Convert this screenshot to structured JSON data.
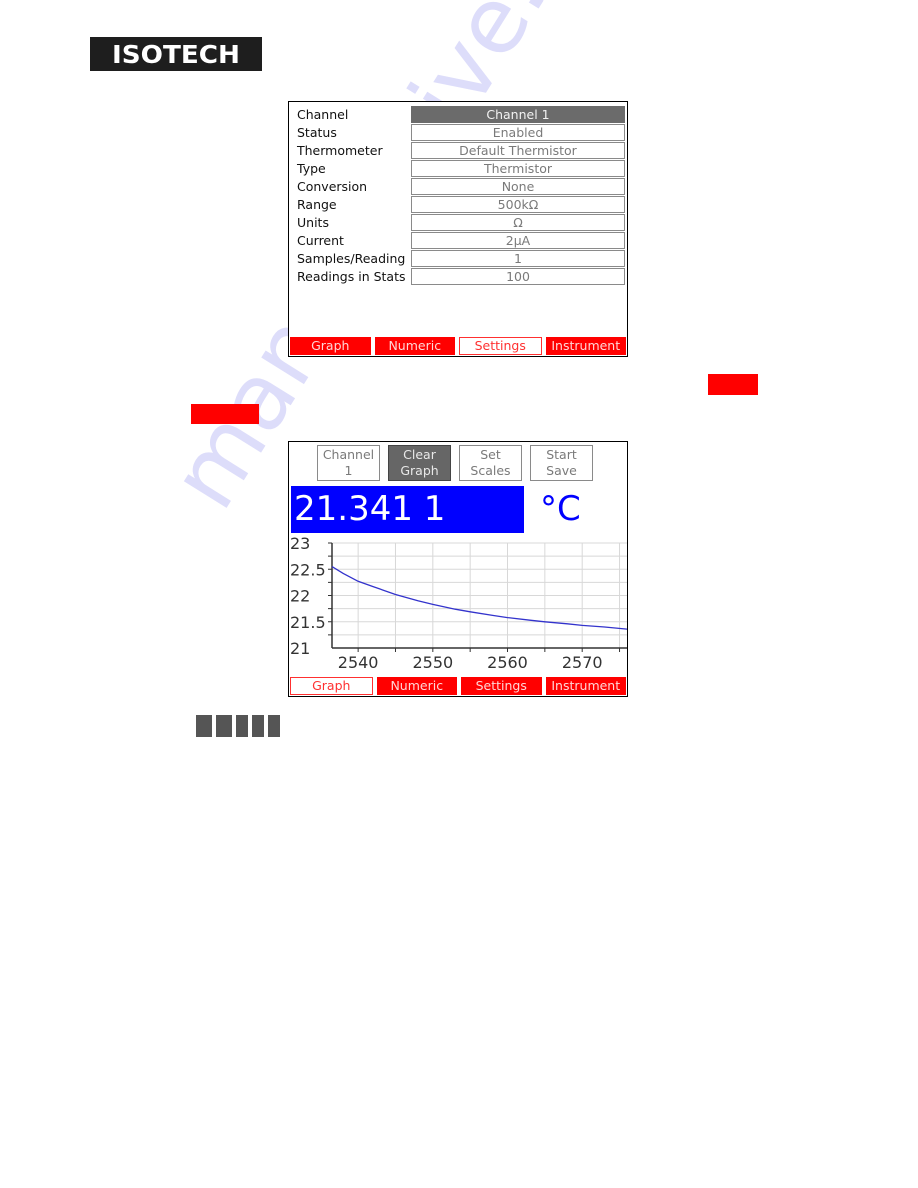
{
  "logo": {
    "text": "ISOTECH"
  },
  "settings_panel": {
    "rows": [
      {
        "label": "Channel",
        "value": "Channel 1",
        "selected": true
      },
      {
        "label": "Status",
        "value": "Enabled"
      },
      {
        "label": "Thermometer",
        "value": "Default Thermistor"
      },
      {
        "label": "Type",
        "value": "Thermistor"
      },
      {
        "label": "Conversion",
        "value": "None"
      },
      {
        "label": "Range",
        "value": "500kΩ"
      },
      {
        "label": "Units",
        "value": "Ω"
      },
      {
        "label": "Current",
        "value": "2µA"
      },
      {
        "label": "Samples/Reading",
        "value": "1"
      },
      {
        "label": "Readings in Stats",
        "value": "100"
      }
    ],
    "tabs": [
      "Graph",
      "Numeric",
      "Settings",
      "Instrument"
    ],
    "active_tab": "Settings"
  },
  "graph_panel": {
    "buttons": {
      "channel": "Channel 1",
      "clear_line1": "Clear",
      "clear_line2": "Graph",
      "scales_line1": "Set",
      "scales_line2": "Scales",
      "save_line1": "Start",
      "save_line2": "Save"
    },
    "reading": "21.341 1",
    "unit": "°C",
    "tabs": [
      "Graph",
      "Numeric",
      "Settings",
      "Instrument"
    ],
    "active_tab": "Graph"
  },
  "colors": {
    "tab_red": "#ff0000",
    "readout_blue": "#0000ff",
    "line_color": "#3333cc",
    "grid": "#d8d8d8"
  },
  "watermark": "manualshive.com",
  "chart_data": {
    "type": "line",
    "title": "",
    "xlabel": "",
    "ylabel": "",
    "xlim": [
      2536.5,
      2576
    ],
    "ylim": [
      21,
      23
    ],
    "x_ticks": [
      2540,
      2550,
      2560,
      2570
    ],
    "y_ticks": [
      21,
      21.5,
      22,
      22.5,
      23
    ],
    "x_tick_labels": [
      "2540",
      "2550",
      "2560",
      "2570"
    ],
    "y_tick_labels": [
      "21",
      "21.5",
      "22",
      "22.5",
      "23"
    ],
    "grid": true,
    "series": [
      {
        "name": "Channel 1",
        "x": [
          2536.5,
          2538,
          2540,
          2542,
          2545,
          2548,
          2550,
          2553,
          2555,
          2558,
          2560,
          2563,
          2565,
          2568,
          2570,
          2573,
          2576
        ],
        "y": [
          22.55,
          22.42,
          22.27,
          22.17,
          22.02,
          21.9,
          21.83,
          21.74,
          21.69,
          21.62,
          21.58,
          21.53,
          21.5,
          21.46,
          21.43,
          21.4,
          21.36
        ]
      }
    ]
  }
}
